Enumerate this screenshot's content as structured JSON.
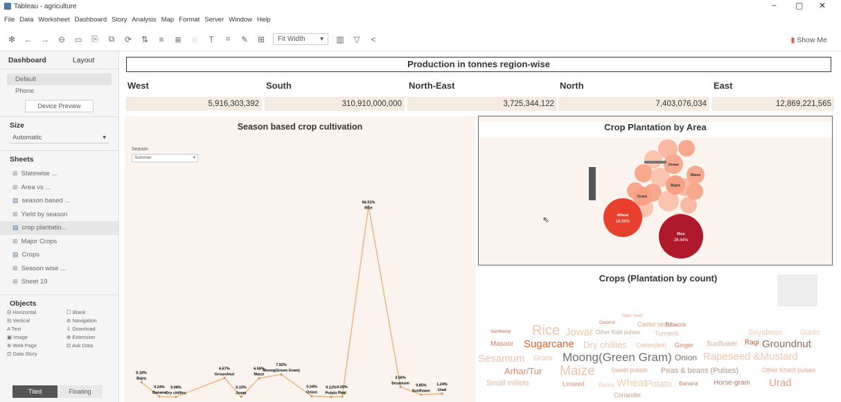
{
  "window": {
    "title": "Tableau - agriculture",
    "min": "−",
    "max": "▢",
    "close": "✕"
  },
  "menu": [
    "File",
    "Data",
    "Worksheet",
    "Dashboard",
    "Story",
    "Analysis",
    "Map",
    "Format",
    "Server",
    "Window",
    "Help"
  ],
  "toolbar": {
    "fit_label": "Fit Width",
    "show_me": "Show Me"
  },
  "left_panel": {
    "tabs": [
      "Dashboard",
      "Layout"
    ],
    "device_items": [
      "Default",
      "Phone"
    ],
    "device_preview": "Device Preview",
    "size_header": "Size",
    "size_value": "Automatic",
    "sheets_header": "Sheets",
    "sheets": [
      {
        "label": "Statewise ...",
        "icon": "grid-icon"
      },
      {
        "label": "Area vs ...",
        "icon": "grid-icon"
      },
      {
        "label": "season based ...",
        "icon": "chart-icon"
      },
      {
        "label": "Yield by season",
        "icon": "grid-icon"
      },
      {
        "label": "crop plantatio...",
        "icon": "chart-icon"
      },
      {
        "label": "Major Crops",
        "icon": "grid-icon"
      },
      {
        "label": "Crops",
        "icon": "chart-icon"
      },
      {
        "label": "Season wise ...",
        "icon": "grid-icon"
      },
      {
        "label": "Sheet 19",
        "icon": "grid-icon"
      }
    ],
    "objects_header": "Objects",
    "objects": [
      "Horizontal",
      "Blank",
      "Vertical",
      "Navigation",
      "Text",
      "Download",
      "Image",
      "Extension",
      "Web Page",
      "Ask Data",
      "Data Story"
    ],
    "tiled": "Tiled",
    "floating": "Floating"
  },
  "dashboard": {
    "production_title": "Production in tonnes region-wise",
    "regions": [
      {
        "name": "West",
        "value": "5,916,303,392"
      },
      {
        "name": "South",
        "value": "310,910,000,000"
      },
      {
        "name": "North-East",
        "value": "3,725,344,122"
      },
      {
        "name": "North",
        "value": "7,403,076,034"
      },
      {
        "name": "East",
        "value": "12,869,221,565"
      }
    ],
    "season_title": "Season based crop cultivation",
    "season_filter_label": "Season",
    "season_filter_value": "Summer",
    "crop_area_title": "Crop Plantation by Area",
    "crop_count_title": "Crops (Plantation by count)"
  },
  "chart_data": [
    {
      "type": "line",
      "title": "Season based crop cultivation",
      "points": [
        {
          "pct": "5.18%",
          "crop": "Bajra",
          "v": 5.18
        },
        {
          "pct": "0.24%",
          "crop": "Banana",
          "v": 0.24
        },
        {
          "pct": "0.08%",
          "crop": "Dry chillies",
          "v": 0.08
        },
        {
          "pct": "6.67%",
          "crop": "Groundnut",
          "v": 6.67
        },
        {
          "pct": "0.15%",
          "crop": "Jowar",
          "v": 0.15
        },
        {
          "pct": "6.58%",
          "crop": "Maize",
          "v": 6.58
        },
        {
          "pct": "7.92%",
          "crop": "Moong(Green Gram)",
          "v": 7.92
        },
        {
          "pct": "0.34%",
          "crop": "Onion",
          "v": 0.34
        },
        {
          "pct": "0.12%",
          "crop": "Potato",
          "v": 0.12
        },
        {
          "pct": "0.20%",
          "crop": "Ragi",
          "v": 0.2
        },
        {
          "pct": "66.51%",
          "crop": "Rice",
          "v": 66.51
        },
        {
          "pct": "3.56%",
          "crop": "Sesamum",
          "v": 3.56
        },
        {
          "pct": "0.85%",
          "crop": "Sunflower",
          "v": 0.85
        },
        {
          "pct": "1.24%",
          "crop": "Urad",
          "v": 1.24
        }
      ]
    },
    {
      "type": "bubble",
      "title": "Crop Plantation by Area",
      "bubbles": [
        {
          "crop": "Rice",
          "pct": "28.44%",
          "v": 28.44,
          "color": "#b0192c"
        },
        {
          "crop": "Wheat",
          "pct": "18.98%",
          "v": 18.98,
          "color": "#e8402e"
        },
        {
          "crop": "Jowar",
          "pct": "",
          "v": 3.2,
          "color": "#f9a98e"
        },
        {
          "crop": "Maize",
          "pct": "",
          "v": 2.8,
          "color": "#f9a98e"
        },
        {
          "crop": "Bajra",
          "pct": "",
          "v": 2.9,
          "color": "#f7a084"
        },
        {
          "crop": "Gram",
          "pct": "",
          "v": 3.0,
          "color": "#f7a084"
        }
      ]
    },
    {
      "type": "wordcloud",
      "title": "Crops (Plantation by count)",
      "words": [
        {
          "w": "Niger seed",
          "c": "#e6a48a",
          "s": 6
        },
        {
          "w": "Coconut",
          "c": "#d36b4e",
          "s": 6
        },
        {
          "w": "Castor seed",
          "c": "#e6a48a",
          "s": 9
        },
        {
          "w": "Tobacco",
          "c": "#b86a52",
          "s": 8
        },
        {
          "w": "Sannhamp",
          "c": "#c95a3b",
          "s": 6
        },
        {
          "w": "Rice",
          "c": "#f0c3a8",
          "s": 20
        },
        {
          "w": "Jowar",
          "c": "#f1c7af",
          "s": 15
        },
        {
          "w": "Other Rabi pulses",
          "c": "#c4a68f",
          "s": 8
        },
        {
          "w": "Turmeric",
          "c": "#e8b39a",
          "s": 9
        },
        {
          "w": "Soyabean",
          "c": "#f2c9b0",
          "s": 11
        },
        {
          "w": "Garlic",
          "c": "#f2c9b0",
          "s": 11
        },
        {
          "w": "Masoor",
          "c": "#d47d5a",
          "s": 10
        },
        {
          "w": "Sugarcane",
          "c": "#d7632e",
          "s": 15
        },
        {
          "w": "Dry chillies",
          "c": "#f0c3a8",
          "s": 13
        },
        {
          "w": "Cotton(lint)",
          "c": "#f0b8a0",
          "s": 9
        },
        {
          "w": "Ginger",
          "c": "#c98062",
          "s": 9
        },
        {
          "w": "Sunflower",
          "c": "#d0a895",
          "s": 10
        },
        {
          "w": "Ragi",
          "c": "#b35a35",
          "s": 10
        },
        {
          "w": "Groundnut",
          "c": "#8b6a55",
          "s": 15
        },
        {
          "w": "Sesamum",
          "c": "#efc1a8",
          "s": 15
        },
        {
          "w": "Gram",
          "c": "#f0c3a8",
          "s": 11
        },
        {
          "w": "Moong(Green Gram)",
          "c": "#6d6d6d",
          "s": 17
        },
        {
          "w": "Onion",
          "c": "#7e6f66",
          "s": 12
        },
        {
          "w": "Rapeseed &Mustard",
          "c": "#f2c7b0",
          "s": 15
        },
        {
          "w": "Arhar/Tur",
          "c": "#d28a64",
          "s": 13
        },
        {
          "w": "Maize",
          "c": "#f0c3a8",
          "s": 19
        },
        {
          "w": "Sweet potato",
          "c": "#e1a98d",
          "s": 9
        },
        {
          "w": "Peas & beans (Pulses)",
          "c": "#b59684",
          "s": 11
        },
        {
          "w": "Other Kharif pulses",
          "c": "#e8a690",
          "s": 9
        },
        {
          "w": "Small millets",
          "c": "#e8b59c",
          "s": 11
        },
        {
          "w": "Linseed",
          "c": "#d48e76",
          "s": 9
        },
        {
          "w": "Barley",
          "c": "#f1c7b4",
          "s": 8
        },
        {
          "w": "Wheat",
          "c": "#f2cfa2",
          "s": 15
        },
        {
          "w": "Potato",
          "c": "#f1c7b0",
          "s": 13
        },
        {
          "w": "Banana",
          "c": "#c97a56",
          "s": 8
        },
        {
          "w": "Horse-gram",
          "c": "#a97660",
          "s": 10
        },
        {
          "w": "Urad",
          "c": "#e6a083",
          "s": 15
        },
        {
          "w": "Coriander",
          "c": "#c79d87",
          "s": 9
        }
      ]
    }
  ]
}
